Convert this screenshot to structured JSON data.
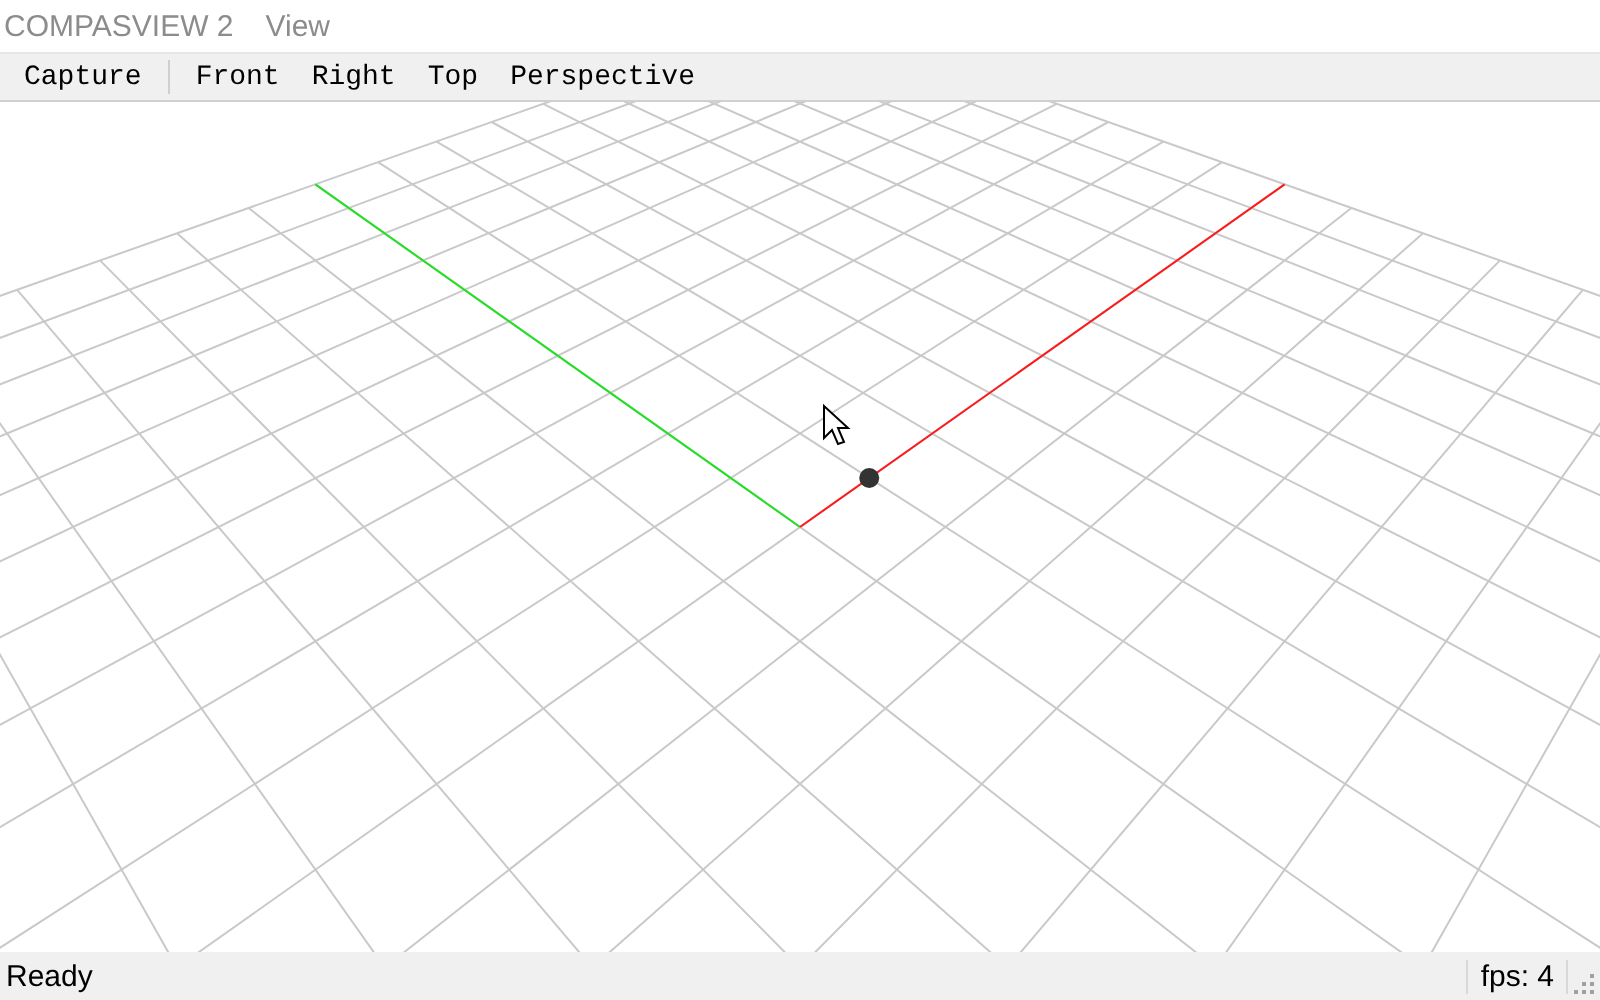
{
  "title": "COMPASVIEW 2",
  "menu": [
    {
      "label": "View"
    }
  ],
  "toolbar": [
    {
      "label": "Capture",
      "kind": "action"
    },
    {
      "label": "Front",
      "kind": "view"
    },
    {
      "label": "Right",
      "kind": "view"
    },
    {
      "label": "Top",
      "kind": "view"
    },
    {
      "label": "Perspective",
      "kind": "view"
    }
  ],
  "status_bar": {
    "message": "Ready",
    "fps": "fps: 4"
  }
}
